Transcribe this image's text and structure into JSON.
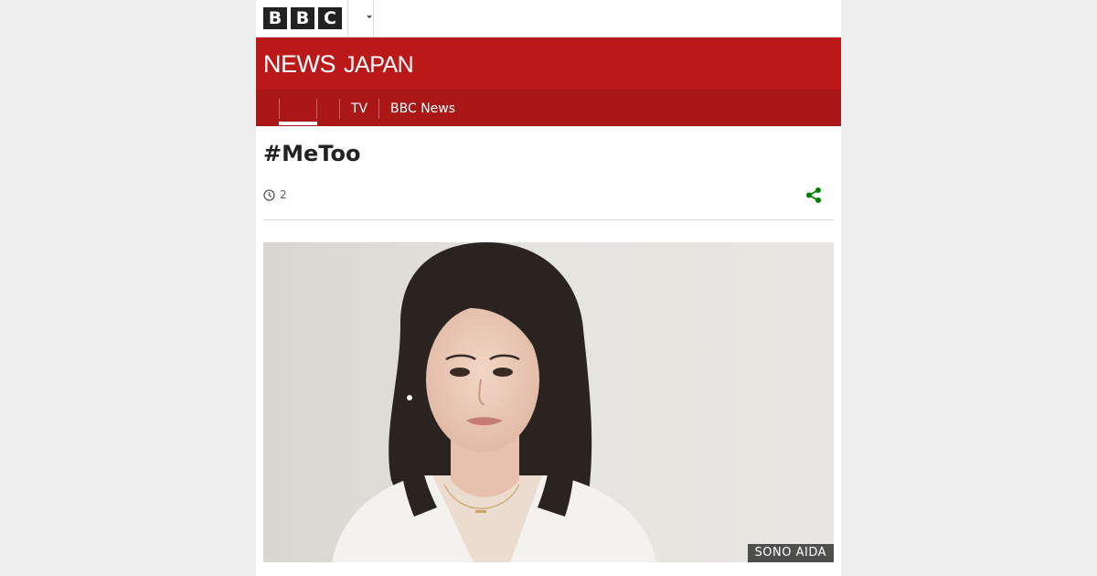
{
  "header": {
    "logo_letters": [
      "B",
      "B",
      "C"
    ],
    "more_icon": "chevron-down-icon"
  },
  "banner": {
    "news": "NEWS",
    "region": "JAPAN",
    "background": "#bb1919"
  },
  "nav": {
    "home_label": "",
    "items": [
      {
        "label": ""
      },
      {
        "label": "TV"
      },
      {
        "label": "BBC News"
      }
    ],
    "background": "#a91717"
  },
  "article": {
    "headline": "#MeToo",
    "meta_value": "2",
    "meta_icon": "clock-icon",
    "share_icon": "share-icon",
    "share_color": "#008000"
  },
  "media": {
    "caption": "SONO AIDA"
  }
}
